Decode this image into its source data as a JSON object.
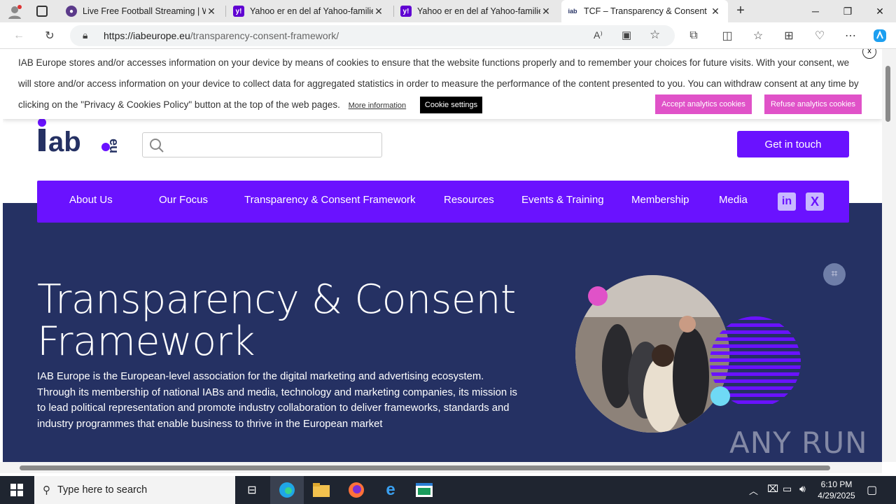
{
  "browser": {
    "tabs": [
      {
        "title": "Live Free Football Streaming | W",
        "favicon": "football-icon"
      },
      {
        "title": "Yahoo er en del af Yahoo-familien",
        "favicon": "yahoo-icon"
      },
      {
        "title": "Yahoo er en del af Yahoo-familien",
        "favicon": "yahoo-icon"
      },
      {
        "title": "TCF – Transparency & Consent Fr",
        "favicon": "iab-icon",
        "active": true
      }
    ],
    "url": "https://iabeurope.eu/transparency-consent-framework/",
    "url_host": "https://iabeurope.eu",
    "url_path": "/transparency-consent-framework/"
  },
  "cookie_banner": {
    "text_line1": "IAB Europe stores and/or accesses information on your device by means of cookies to ensure that the website functions properly and to remember your choices for future visits. With your consent, we",
    "text_line2": "will store and/or access information on your device to collect data for aggregated statistics in order to measure the performance of the content presented to you. You can withdraw consent at any time by",
    "text_line3": "clicking on the \"Privacy & Cookies Policy\" button at the top of the web pages.",
    "more_info": "More information",
    "settings": "Cookie settings",
    "accept": "Accept analytics cookies",
    "refuse": "Refuse analytics cookies",
    "close": "x"
  },
  "site": {
    "logo": "iab.eu",
    "get_in_touch": "Get in touch",
    "nav": [
      "About Us",
      "Our Focus",
      "Transparency & Consent Framework",
      "Resources",
      "Events & Training",
      "Membership",
      "Media"
    ],
    "hero_title_line1": "Transparency & Consent",
    "hero_title_line2": "Framework",
    "hero_text": "IAB Europe is the European-level association for the digital marketing and advertising ecosystem. Through its membership of national IABs and media, technology and marketing companies, its mission is to lead political representation and promote industry collaboration to deliver frameworks, standards and industry programmes that enable business to thrive in the European market"
  },
  "watermark": "ANY RUN",
  "taskbar": {
    "search_placeholder": "Type here to search",
    "time": "6:10 PM",
    "date": "4/29/2025"
  },
  "colors": {
    "brand_purple": "#6a12ff",
    "hero_navy": "#253163",
    "cookie_pink": "#e052c8"
  }
}
